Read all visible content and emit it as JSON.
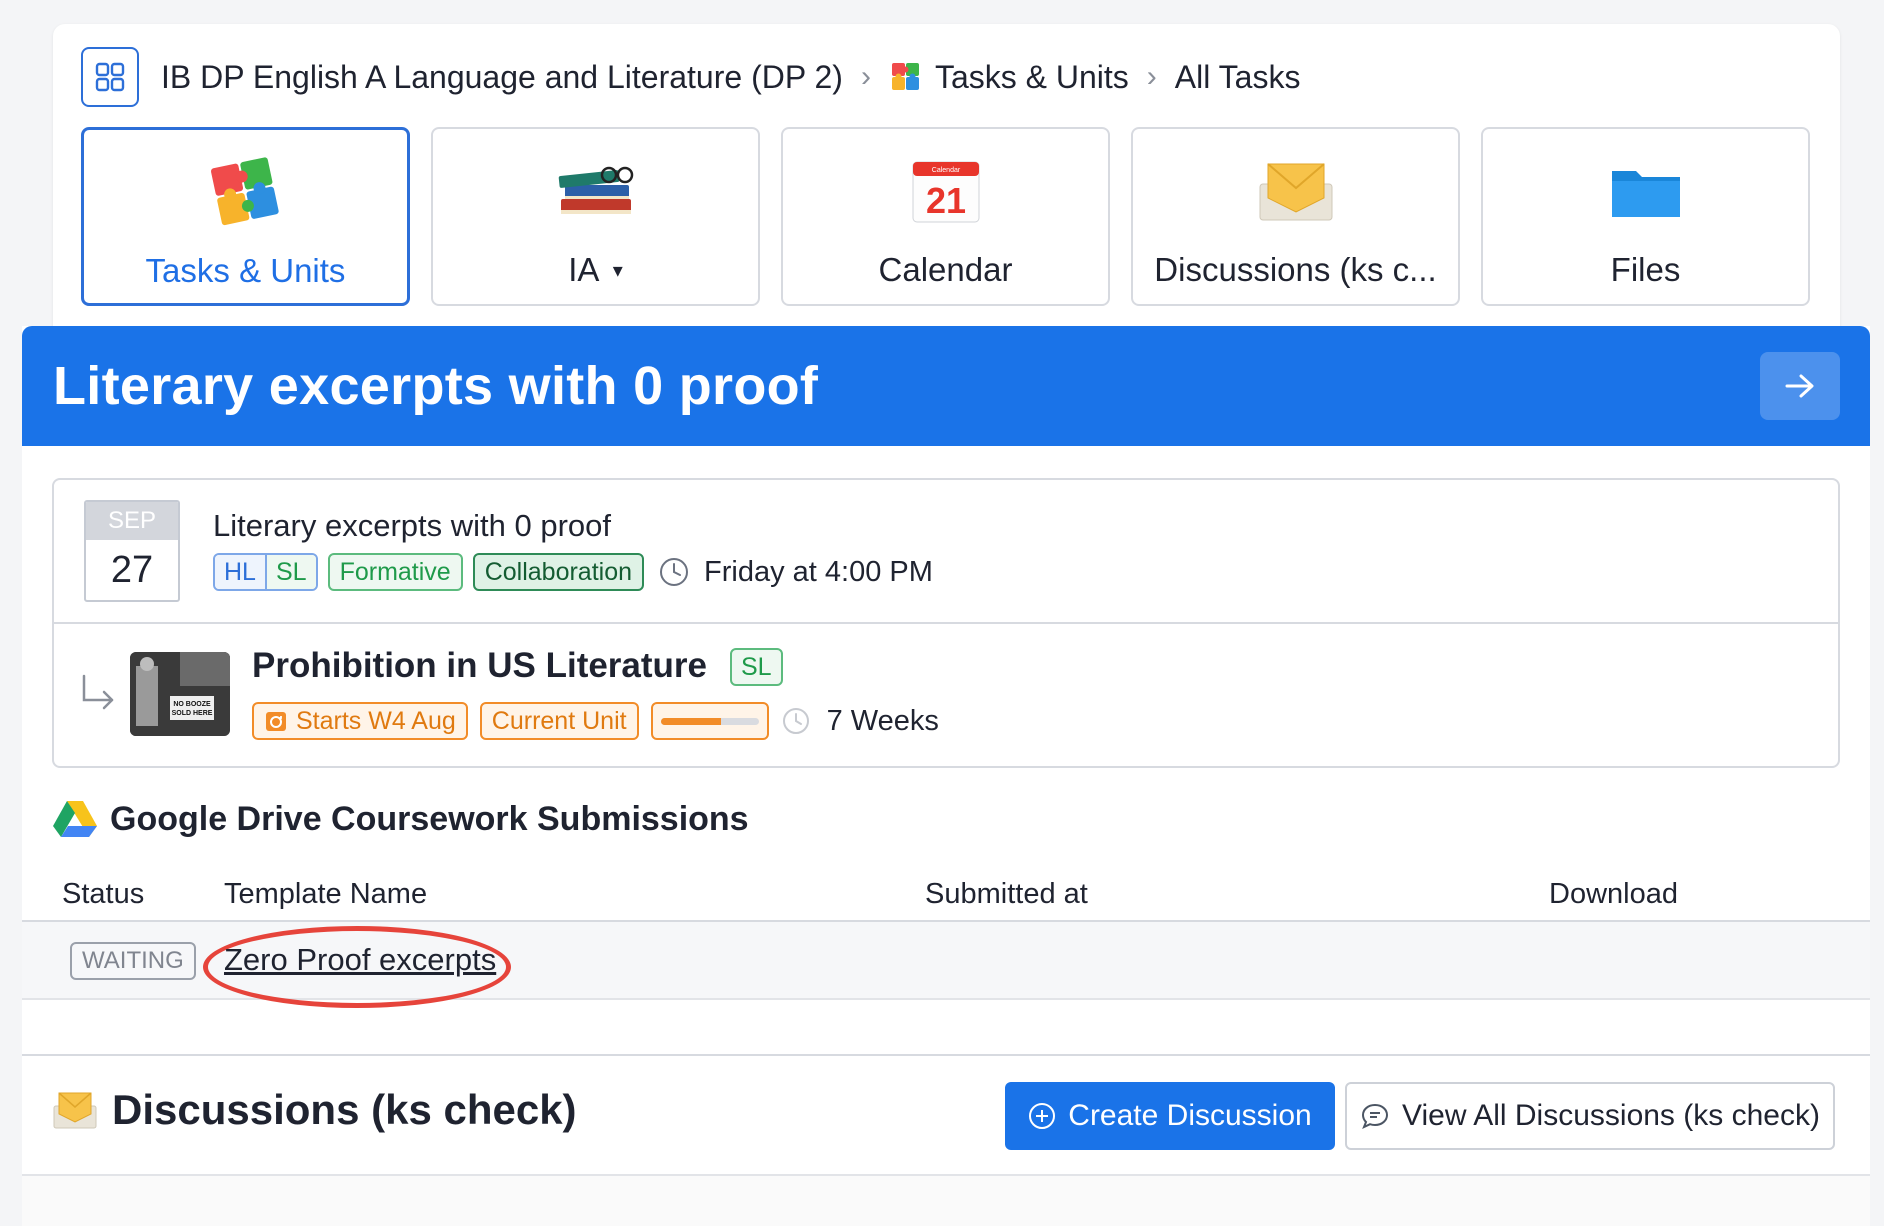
{
  "breadcrumb": {
    "course": "IB DP English A Language and Literature (DP 2)",
    "section": "Tasks & Units",
    "page": "All Tasks"
  },
  "tiles": [
    {
      "label": "Tasks & Units",
      "icon": "puzzle-icon",
      "active": true
    },
    {
      "label": "IA",
      "icon": "books-icon",
      "dropdown": true
    },
    {
      "label": "Calendar",
      "icon": "calendar-icon",
      "calendar_day": "21",
      "calendar_header": "Calendar"
    },
    {
      "label": "Discussions (ks c...",
      "icon": "envelope-icon"
    },
    {
      "label": "Files",
      "icon": "folder-icon"
    }
  ],
  "hero": {
    "title": "Literary excerpts with 0 proof"
  },
  "task": {
    "month": "SEP",
    "day": "27",
    "title": "Literary excerpts with 0 proof",
    "level_tags": [
      "HL",
      "SL"
    ],
    "type_tag": "Formative",
    "mode_tag": "Collaboration",
    "due": "Friday at 4:00 PM"
  },
  "unit": {
    "title": "Prohibition in US Literature",
    "level": "SL",
    "starts": "Starts W4 Aug",
    "status": "Current Unit",
    "progress_fraction": 0.62,
    "duration": "7 Weeks",
    "thumb_sign_line1": "NO BOOZE",
    "thumb_sign_line2": "SOLD HERE"
  },
  "drive": {
    "title": "Google Drive Coursework Submissions",
    "columns": [
      "Status",
      "Template Name",
      "Submitted at",
      "Download"
    ],
    "rows": [
      {
        "status": "WAITING",
        "template": "Zero Proof excerpts",
        "submitted": "",
        "download": ""
      }
    ]
  },
  "discussions": {
    "title": "Discussions (ks check)",
    "create_label": "Create Discussion",
    "view_label": "View All Discussions (ks check)"
  },
  "colors": {
    "accent": "#1a73e8",
    "orange": "#f28c28",
    "green": "#1f9a4a",
    "highlight_ring": "#e6443b"
  }
}
